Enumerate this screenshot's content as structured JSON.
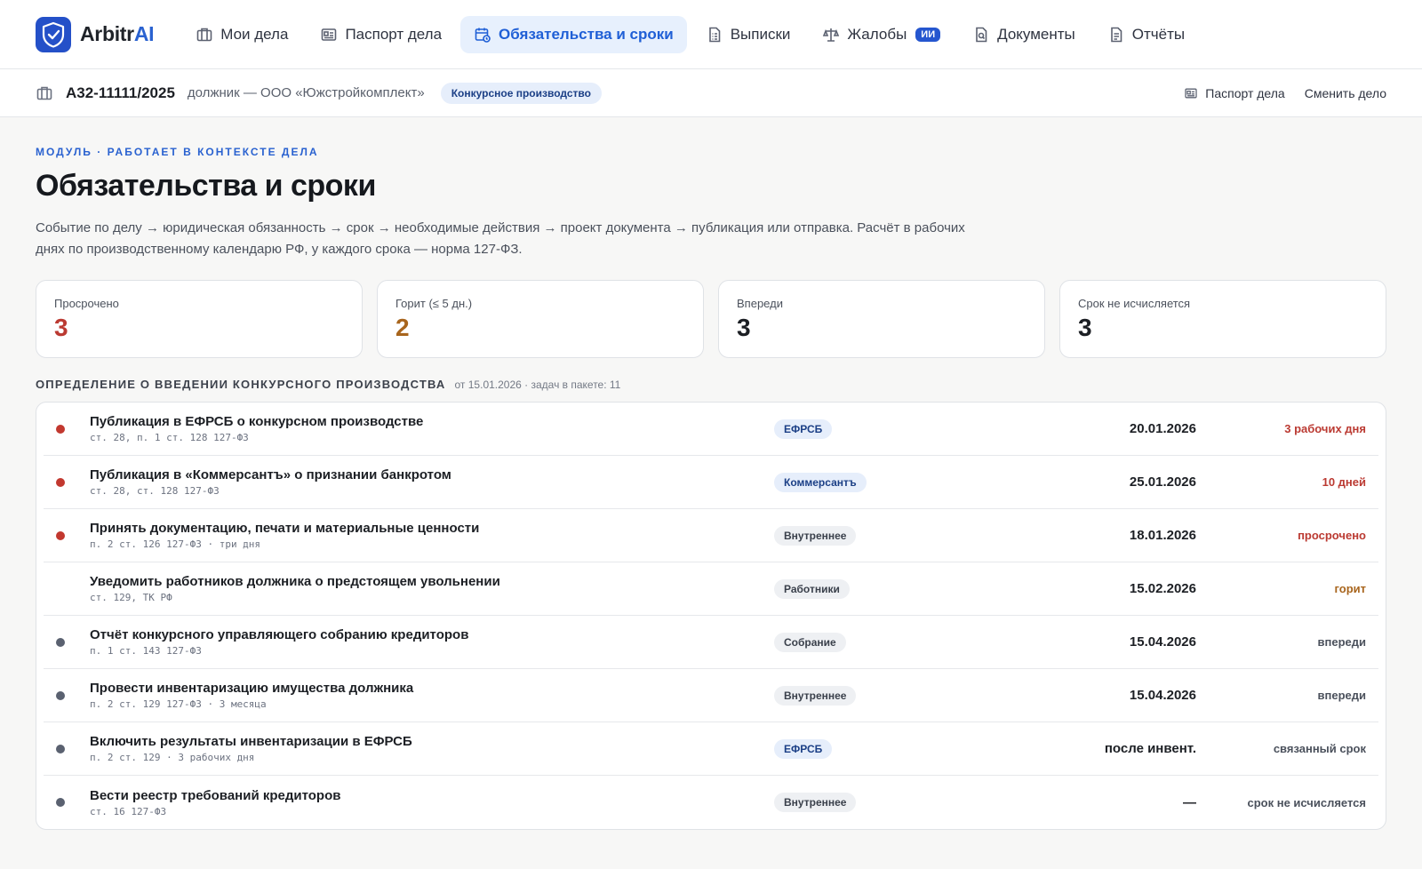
{
  "brand": {
    "name_dark": "Arbitr",
    "name_blue": "AI",
    "accent": "#2a62d0"
  },
  "nav": [
    {
      "label": "Мои дела",
      "icon": "briefcase-icon"
    },
    {
      "label": "Паспорт дела",
      "icon": "id-card-icon"
    },
    {
      "label": "Обязательства и сроки",
      "icon": "calendar-clock-icon",
      "active": true
    },
    {
      "label": "Выписки",
      "icon": "document-list-icon"
    },
    {
      "label": "Жалобы",
      "icon": "scales-icon",
      "badge": "ИИ"
    },
    {
      "label": "Документы",
      "icon": "document-search-icon"
    },
    {
      "label": "Отчёты",
      "icon": "report-icon"
    }
  ],
  "case": {
    "number": "А32-11111/2025",
    "debtor": "должник — ООО «Южстройкомплект»",
    "stage": "Конкурсное производство",
    "link_passport": "Паспорт дела",
    "link_change": "Сменить дело"
  },
  "page": {
    "eyebrow": "МОДУЛЬ · РАБОТАЕТ В КОНТЕКСТЕ ДЕЛА",
    "title": "Обязательства и сроки",
    "description": "Событие по делу → юридическая обязанность → срок → необходимые действия → проект документа → публикация или отправка. Расчёт в рабочих днях по производственному календарю РФ, у каждого срока — норма 127-ФЗ."
  },
  "stats": [
    {
      "label": "Просрочено",
      "value": "3",
      "color": "#bb3a32"
    },
    {
      "label": "Горит (≤ 5 дн.)",
      "value": "2",
      "color": "#a8651d"
    },
    {
      "label": "Впереди",
      "value": "3",
      "color": "#1c1f24"
    },
    {
      "label": "Срок не исчисляется",
      "value": "3",
      "color": "#1c1f24"
    }
  ],
  "section": {
    "title": "ОПРЕДЕЛЕНИЕ О ВВЕДЕНИИ КОНКУРСНОГО ПРОИЗВОДСТВА",
    "meta": "от 15.01.2026 · задач в пакете: 11"
  },
  "tasks": [
    {
      "title": "Публикация в ЕФРСБ о конкурсном производстве",
      "ref": "ст. 28, п. 1 ст. 128 127-ФЗ",
      "chip": "ЕФРСБ",
      "date": "20.01.2026",
      "status": "3 рабочих дня"
    },
    {
      "title": "Публикация в «Коммерсантъ» о признании банкротом",
      "ref": "ст. 28, ст. 128 127-ФЗ",
      "chip": "Коммерсантъ",
      "date": "25.01.2026",
      "status": "10 дней"
    },
    {
      "title": "Принять документацию, печати и материальные ценности",
      "ref": "п. 2 ст. 126 127-ФЗ · три дня",
      "chip": "Внутреннее",
      "date": "18.01.2026",
      "status": "просрочено"
    },
    {
      "title": "Уведомить работников должника о предстоящем увольнении",
      "ref": "ст. 129, ТК РФ",
      "chip": "Работники",
      "date": "15.02.2026",
      "status": "горит"
    },
    {
      "title": "Отчёт конкурсного управляющего собранию кредиторов",
      "ref": "п. 1 ст. 143 127-ФЗ",
      "chip": "Собрание",
      "date": "15.04.2026",
      "status": "впереди"
    },
    {
      "title": "Провести инвентаризацию имущества должника",
      "ref": "п. 2 ст. 129 127-ФЗ · 3 месяца",
      "chip": "Внутреннее",
      "date": "15.04.2026",
      "status": "впереди"
    },
    {
      "title": "Включить результаты инвентаризации в ЕФРСБ",
      "ref": "п. 2 ст. 129 · 3 рабочих дня",
      "chip": "ЕФРСБ",
      "date": "после инвент.",
      "status": "связанный срок"
    },
    {
      "title": "Вести реестр требований кредиторов",
      "ref": "ст. 16 127-ФЗ",
      "chip": "Внутреннее",
      "date": "—",
      "status": "срок не исчисляется"
    }
  ]
}
